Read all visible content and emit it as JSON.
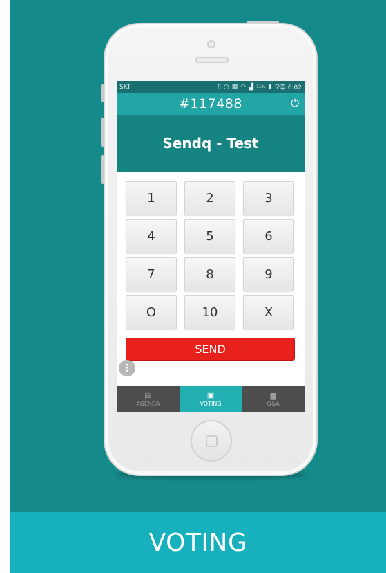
{
  "status_bar": {
    "carrier": "SKT",
    "icons": [
      "vibrate-icon",
      "alarm-icon",
      "nfc-icon",
      "wifi-icon",
      "signal-icon",
      "battery-icon"
    ],
    "battery_percent": "11%",
    "time": "오후 6:02"
  },
  "header": {
    "room_code": "#117488",
    "power_icon": "power-icon"
  },
  "session": {
    "title": "Sendq - Test"
  },
  "keypad": {
    "keys": [
      "1",
      "2",
      "3",
      "4",
      "5",
      "6",
      "7",
      "8",
      "9",
      "O",
      "10",
      "X"
    ]
  },
  "send_label": "SEND",
  "more_icon": "more-vertical-icon",
  "tabs": [
    {
      "label": "AGENDA",
      "icon": "agenda-icon",
      "active": false
    },
    {
      "label": "VOTING",
      "icon": "voting-icon",
      "active": true
    },
    {
      "label": "Q&A",
      "icon": "qa-icon",
      "active": false
    }
  ],
  "caption": "VOTING",
  "colors": {
    "background_teal": "#158a8a",
    "caption_bar": "#16b1bd",
    "header": "#22a5a5",
    "title_band": "#168383",
    "send_button": "#e8211c",
    "tab_active": "#22b0b3",
    "tab_bar": "#4d4d4d"
  }
}
